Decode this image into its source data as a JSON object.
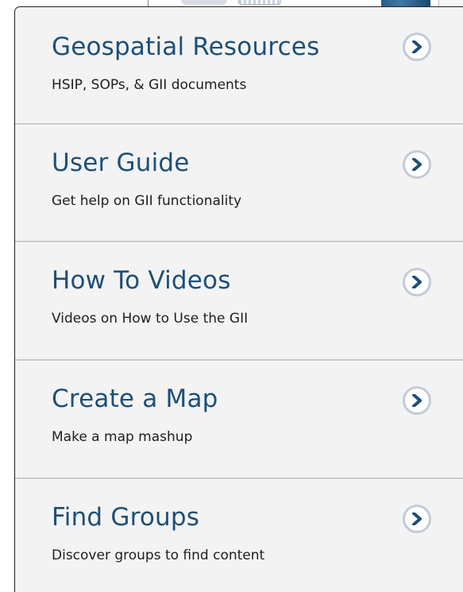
{
  "menu": {
    "items": [
      {
        "title": "Geospatial Resources",
        "subtitle": "HSIP, SOPs, & GII documents",
        "icon": "chevron-right-circle-icon"
      },
      {
        "title": "User Guide",
        "subtitle": "Get help on GII functionality",
        "icon": "chevron-right-circle-icon"
      },
      {
        "title": "How To Videos",
        "subtitle": "Videos on How to Use the GII",
        "icon": "chevron-right-circle-icon"
      },
      {
        "title": "Create a Map",
        "subtitle": "Make a map mashup",
        "icon": "chevron-right-circle-icon"
      },
      {
        "title": "Find Groups",
        "subtitle": "Discover groups to find content",
        "icon": "chevron-right-circle-icon"
      }
    ]
  },
  "colors": {
    "title": "#1e4f78",
    "subtitle": "#1e1e1e",
    "panel": "#f3f3f3",
    "chevron": "#1e4f78",
    "chevron_ring": "#c3cbd6"
  }
}
